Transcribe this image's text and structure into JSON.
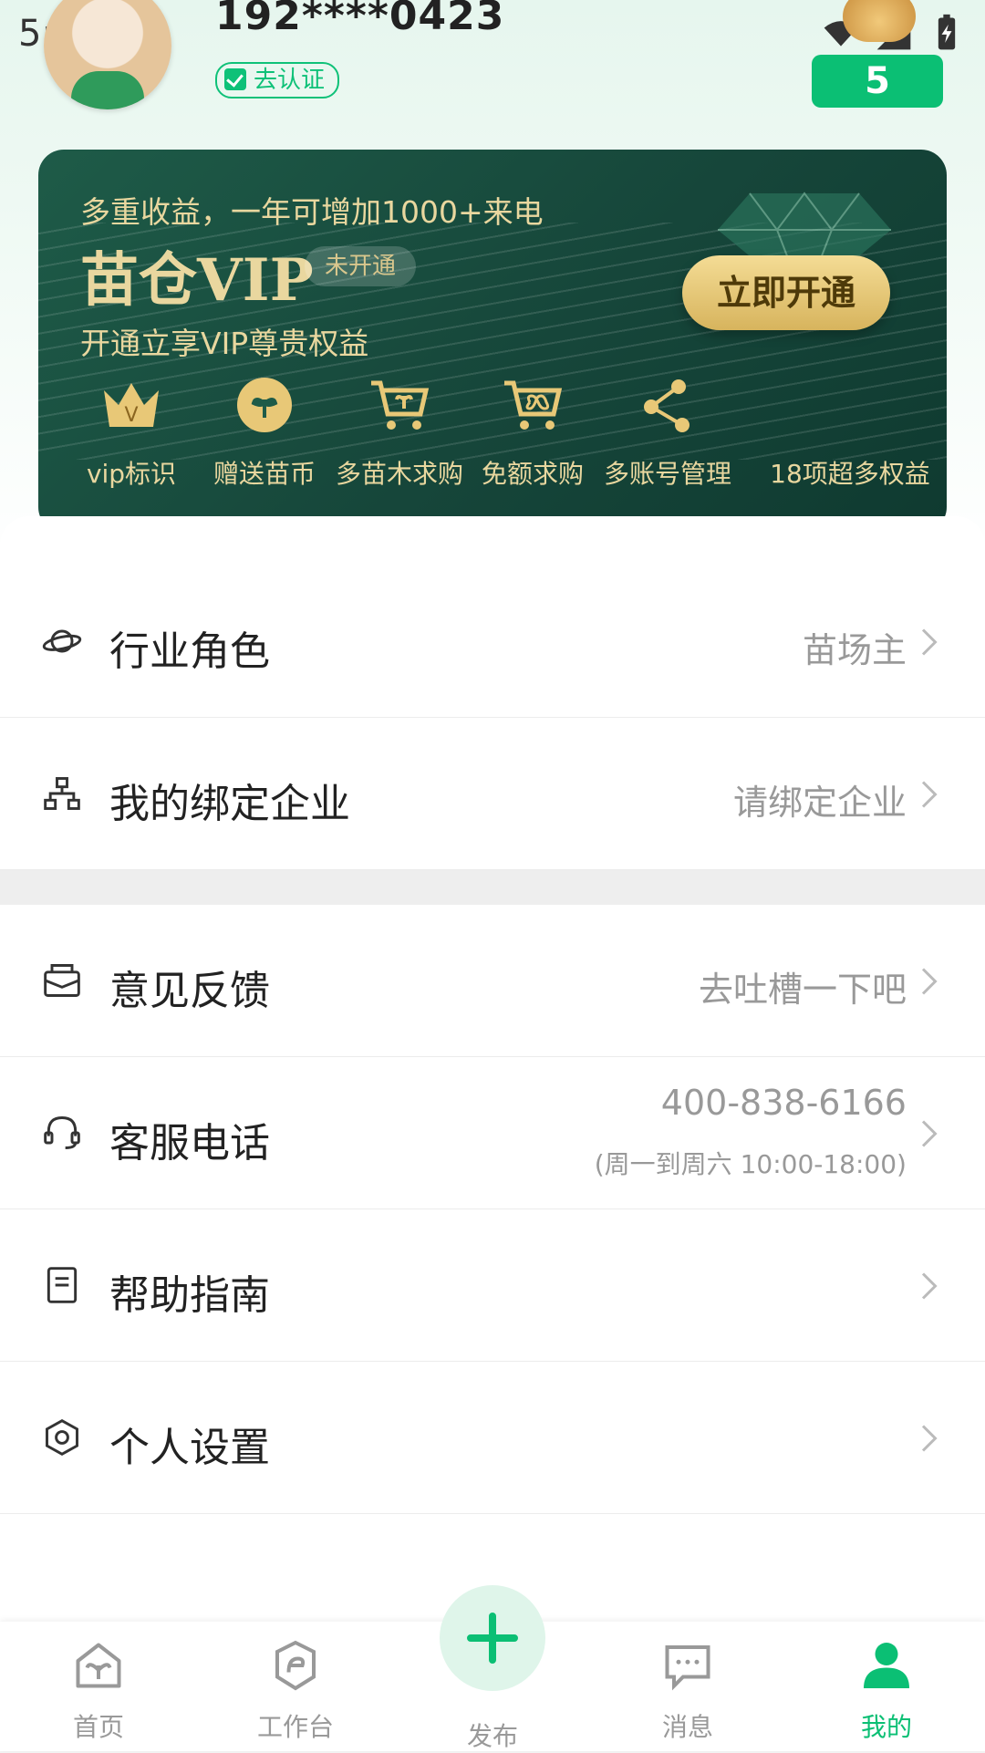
{
  "status_bar": {
    "time": "5:47"
  },
  "profile": {
    "username": "192****0423",
    "verify_label": "去认证",
    "badge_count": "5"
  },
  "vip": {
    "subtitle": "多重收益，一年可增加1000+来电",
    "title": "苗仓VIP",
    "status": "未开通",
    "desc": "开通立享VIP尊贵权益",
    "open_button": "立即开通",
    "benefits": [
      {
        "label": "vip标识",
        "icon": "crown-icon"
      },
      {
        "label": "赠送苗币",
        "icon": "seedling-coin-icon"
      },
      {
        "label": "多苗木求购",
        "icon": "cart-plant-icon"
      },
      {
        "label": "免额求购",
        "icon": "cart-infinite-icon"
      },
      {
        "label": "多账号管理",
        "icon": "share-nodes-icon"
      },
      {
        "label": "18项超多权益",
        "icon": ""
      }
    ]
  },
  "menu": {
    "industry_role": {
      "label": "行业角色",
      "value": "苗场主",
      "icon": "planet-icon"
    },
    "bind_company": {
      "label": "我的绑定企业",
      "value": "请绑定企业",
      "icon": "org-chart-icon"
    },
    "feedback": {
      "label": "意见反馈",
      "value": "去吐槽一下吧",
      "icon": "mail-open-icon"
    },
    "service_phone": {
      "label": "客服电话",
      "number": "400-838-6166",
      "hours": "(周一到周六 10:00-18:00)",
      "icon": "headset-icon"
    },
    "help": {
      "label": "帮助指南",
      "icon": "document-icon"
    },
    "settings": {
      "label": "个人设置",
      "icon": "settings-hex-icon"
    }
  },
  "bottom_nav": {
    "home": "首页",
    "workbench": "工作台",
    "publish": "发布",
    "messages": "消息",
    "mine": "我的"
  },
  "colors": {
    "accent": "#0bbf74",
    "vip_bg": "#16463a",
    "vip_gold": "#e9d79f"
  }
}
